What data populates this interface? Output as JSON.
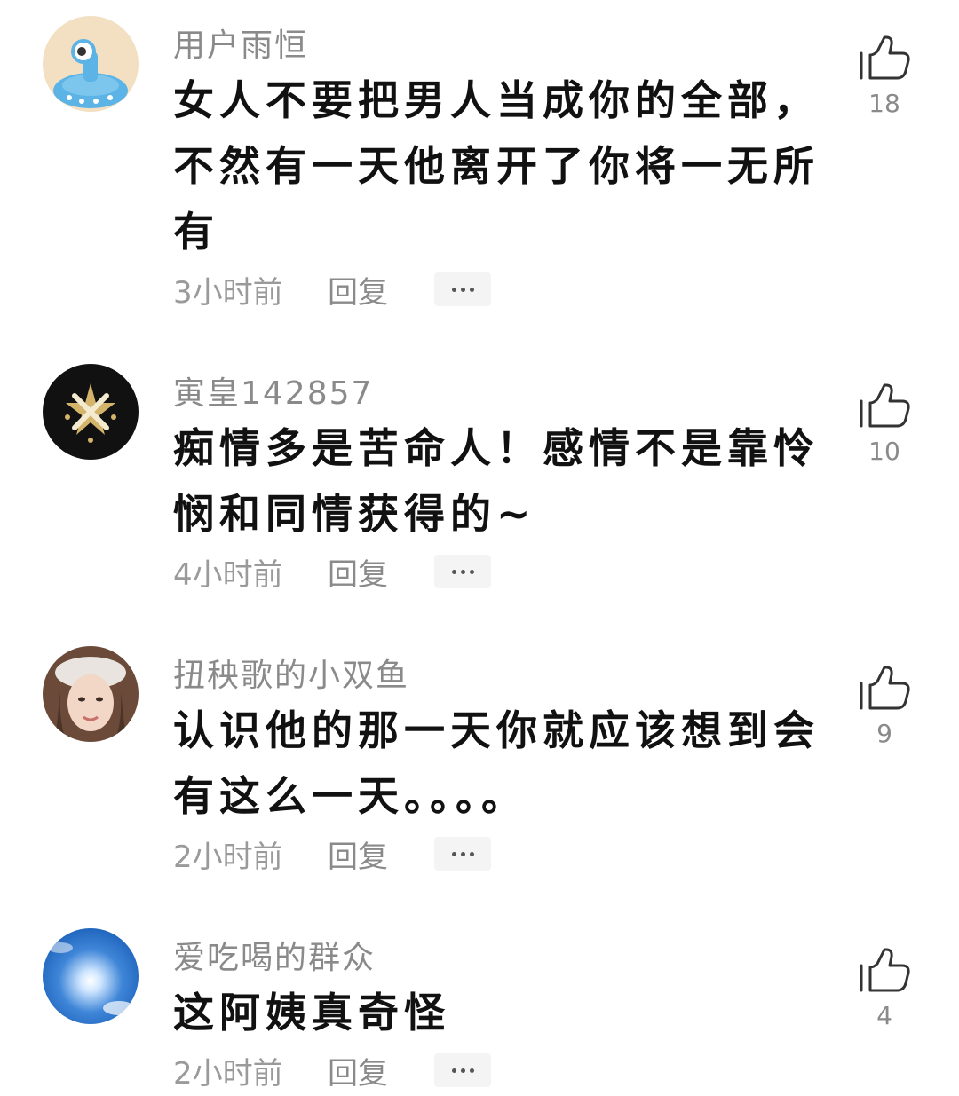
{
  "comments": [
    {
      "username": "用户雨恒",
      "content": "女人不要把男人当成你的全部，不然有一天他离开了你将一无所有",
      "time": "3小时前",
      "reply_label": "回复",
      "likes": "18",
      "avatar_icon": "cartoon-creature-avatar",
      "avatar_colors": [
        "#f3e0c2",
        "#5bb3e6"
      ]
    },
    {
      "username": "寅皇142857",
      "content": "痴情多是苦命人！感情不是靠怜悯和同情获得的~",
      "time": "4小时前",
      "reply_label": "回复",
      "likes": "10",
      "avatar_icon": "gold-star-emblem-avatar",
      "avatar_colors": [
        "#111111",
        "#d4b36a"
      ]
    },
    {
      "username": "扭秧歌的小双鱼",
      "content": "认识他的那一天你就应该想到会有这么一天。。。。",
      "time": "2小时前",
      "reply_label": "回复",
      "likes": "9",
      "avatar_icon": "person-photo-avatar",
      "avatar_colors": [
        "#6b4a3a",
        "#f2d6c6"
      ]
    },
    {
      "username": "爱吃喝的群众",
      "content": "这阿姨真奇怪",
      "time": "2小时前",
      "reply_label": "回复",
      "likes": "4",
      "avatar_icon": "sun-sky-avatar",
      "avatar_colors": [
        "#1a5fb8",
        "#ffffff"
      ]
    }
  ]
}
